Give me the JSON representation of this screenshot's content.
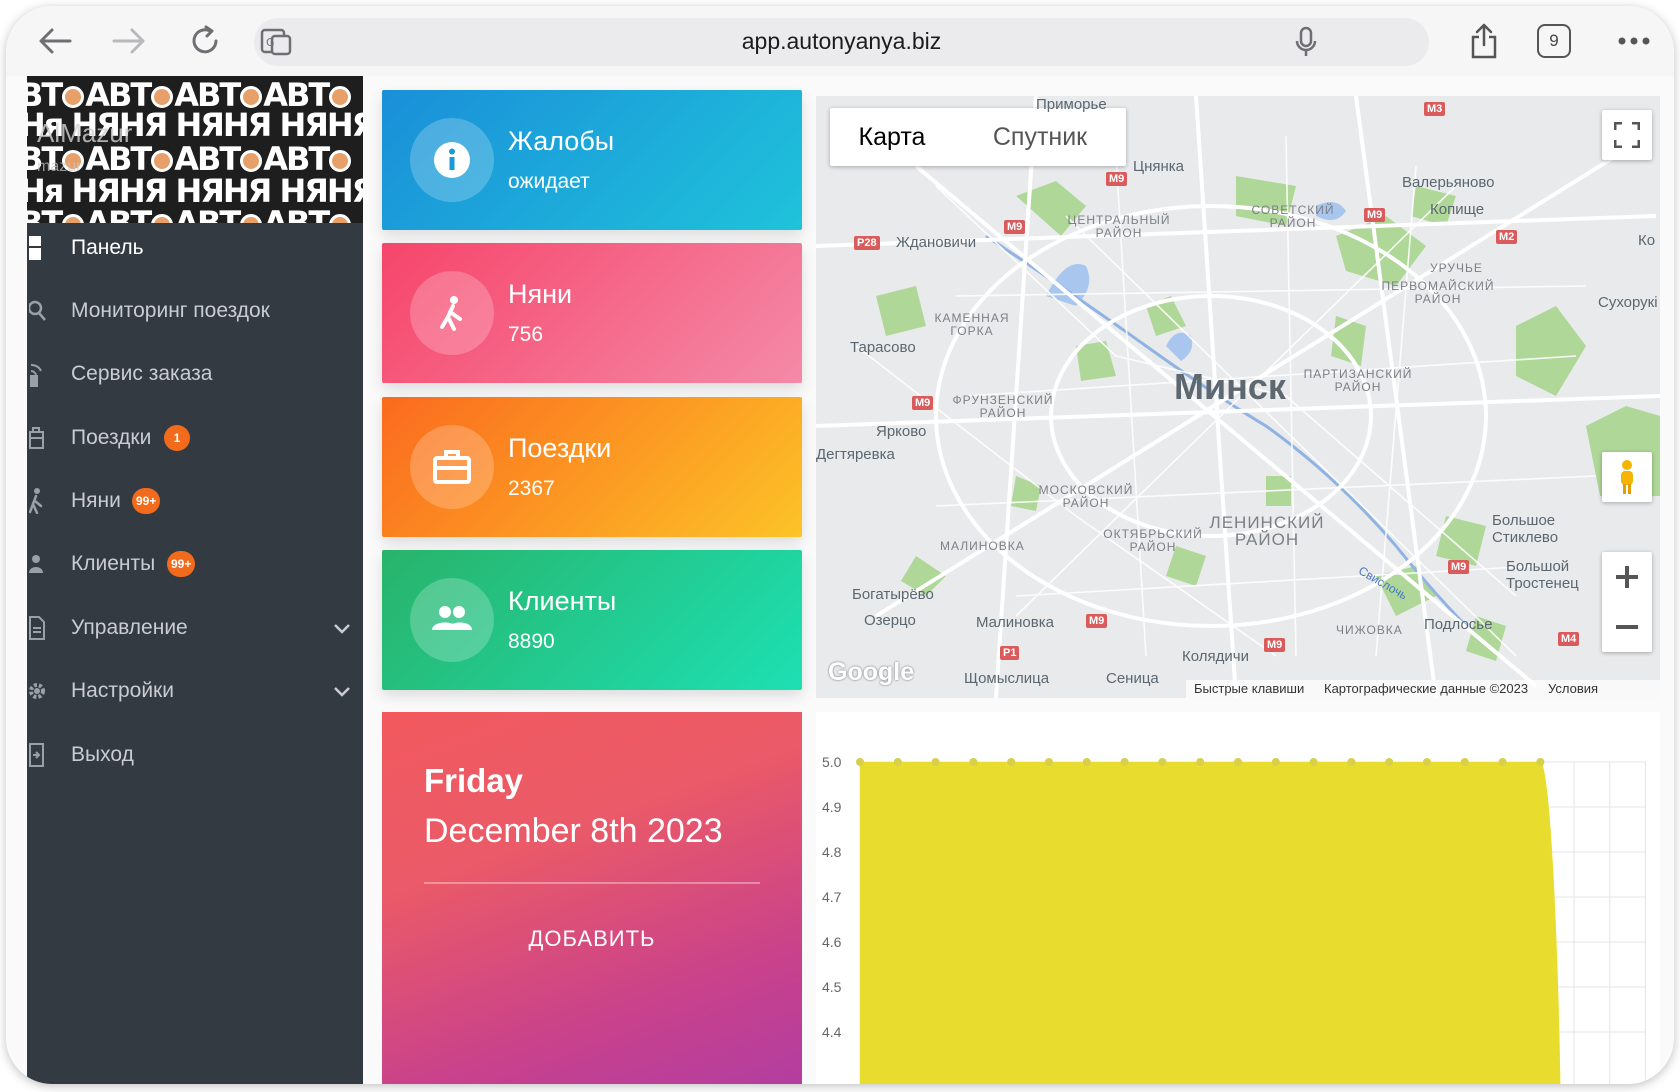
{
  "browser": {
    "url": "app.autonyanya.biz",
    "tab_count": "9"
  },
  "sidebar": {
    "profile": {
      "name": "AlMazur",
      "subtitle": "mazur",
      "pattern_text": "АВТО НЯНЯ"
    },
    "items": [
      {
        "label": "Панель",
        "icon": "dashboard-icon",
        "active": true
      },
      {
        "label": "Мониторинг поездок",
        "icon": "search-icon"
      },
      {
        "label": "Сервис заказа",
        "icon": "signal-icon"
      },
      {
        "label": "Поездки",
        "icon": "suitcase-icon",
        "badge": "1"
      },
      {
        "label": "Няни",
        "icon": "walker-icon",
        "badge": "99+"
      },
      {
        "label": "Клиенты",
        "icon": "people-icon",
        "badge": "99+"
      },
      {
        "label": "Управление",
        "icon": "document-icon",
        "expandable": true
      },
      {
        "label": "Настройки",
        "icon": "gear-icon",
        "expandable": true
      },
      {
        "label": "Выход",
        "icon": "exit-icon"
      }
    ]
  },
  "cards": [
    {
      "title": "Жалобы",
      "value": "ожидает",
      "icon": "info-icon",
      "colors": [
        "#1a8fd9",
        "#1fc3da"
      ]
    },
    {
      "title": "Няни",
      "value": "756",
      "icon": "walker-icon",
      "colors": [
        "#f6456a",
        "#f48aa8"
      ]
    },
    {
      "title": "Поездки",
      "value": "2367",
      "icon": "suitcase-icon",
      "colors": [
        "#fb6a1e",
        "#fcc327"
      ]
    },
    {
      "title": "Клиенты",
      "value": "8890",
      "icon": "people-icon",
      "colors": [
        "#28b36a",
        "#1de0b3"
      ]
    }
  ],
  "date_card": {
    "day": "Friday",
    "date": "December 8th 2023",
    "button": "ДОБАВИТЬ"
  },
  "map": {
    "tab_map": "Карта",
    "tab_satellite": "Спутник",
    "city": "Минск",
    "labels": {
      "primorye": "Приморье",
      "tsnyanka": "Цнянка",
      "valeryanovo": "Валерьяново",
      "kopishche": "Копище",
      "zhdanovichi": "Ждановичи",
      "tarasovo": "Тарасово",
      "yarkovo": "Ярково",
      "degtyarevka": "Дегтяревка",
      "bogatyrevo": "Богатырёво",
      "ozertso": "Озерцо",
      "malinovka": "Малиновка",
      "kolyadichi": "Колядичи",
      "shchomyslitsa": "Щомыслица",
      "senitsa": "Сеница",
      "podlosye": "Подлосье",
      "sukharevo": "Сухорукі",
      "ko": "Ко",
      "bolshoe_stiklevo": "Большое Стиклево",
      "bolshoy_trostenets": "Большой Тростенец",
      "svisloch": "Свислочь",
      "uruchye": "УРУЧЬЕ",
      "chizhovka": "ЧИЖОВКА",
      "malinovka_dist": "МАЛИНОВКА",
      "kamennaya_gorka": "КАМЕННАЯ ГОРКА"
    },
    "districts": {
      "tsentralny": "ЦЕНТРАЛЬНЫЙ РАЙОН",
      "sovetsky": "СОВЕТСКИЙ РАЙОН",
      "pervomaisky": "ПЕРВОМАЙСКИЙ РАЙОН",
      "partizansky": "ПАРТИЗАНСКИЙ РАЙОН",
      "frunzensky": "ФРУНЗЕНСКИЙ РАЙОН",
      "moskovsky": "МОСКОВСКИЙ РАЙОН",
      "leninsky": "ЛЕНИНСКИЙ РАЙОН",
      "oktyabrsky": "ОКТЯБРЬСКИЙ РАЙОН"
    },
    "roads": {
      "m3": "M3",
      "m9": "M9",
      "m2": "M2",
      "m4": "M4",
      "p28": "P28",
      "p1": "P1"
    },
    "google": "Google",
    "footer": {
      "shortcuts": "Быстрые клавиши",
      "data": "Картографические данные ©2023",
      "terms": "Условия"
    }
  },
  "chart_data": {
    "type": "area",
    "y_ticks": [
      "5.0",
      "4.9",
      "4.8",
      "4.7",
      "4.6",
      "4.5",
      "4.4"
    ],
    "ylim": [
      4.4,
      5.0
    ],
    "points": 19,
    "values": [
      5.0,
      5.0,
      5.0,
      5.0,
      5.0,
      5.0,
      5.0,
      5.0,
      5.0,
      5.0,
      5.0,
      5.0,
      5.0,
      5.0,
      5.0,
      5.0,
      5.0,
      5.0,
      5.0
    ],
    "fill_color": "#e8dd2f",
    "point_color": "#d8cf4a",
    "grid": true
  }
}
